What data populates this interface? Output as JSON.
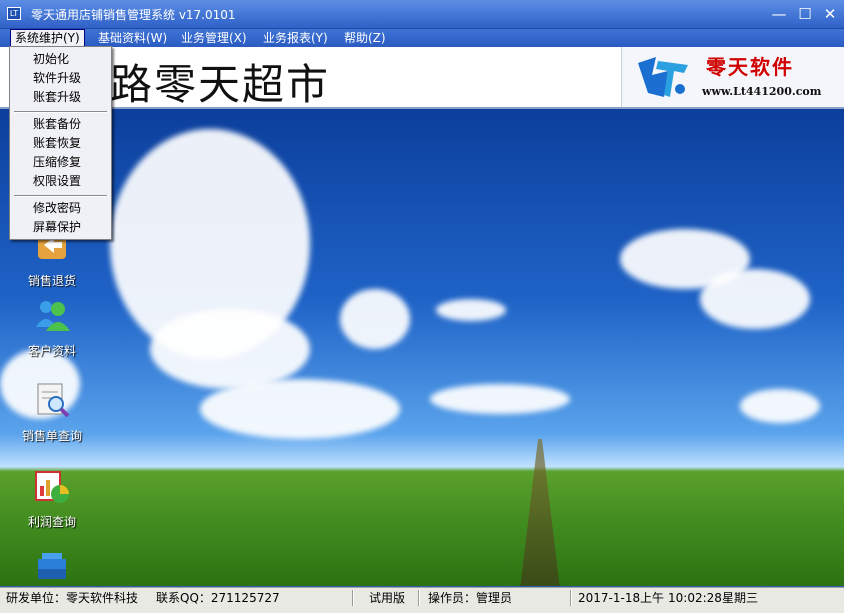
{
  "window": {
    "title": "零天通用店铺销售管理系统  v17.0101",
    "icon_text": "LT",
    "minimize_glyph": "—",
    "maximize_glyph": "☐",
    "close_glyph": "✕"
  },
  "menu": [
    {
      "label": "系统维护(Y)"
    },
    {
      "label": "基础资料(W)"
    },
    {
      "label": "业务管理(X)"
    },
    {
      "label": "业务报表(Y)"
    },
    {
      "label": "帮助(Z)"
    }
  ],
  "banner": {
    "title": "路零天超市",
    "logo_name": "零天软件",
    "logo_url": "www.Lt441200.com"
  },
  "dropdown": {
    "groups": [
      [
        "初始化",
        "软件升级",
        "账套升级"
      ],
      [
        "账套备份",
        "账套恢复",
        "压缩修复",
        "权限设置"
      ],
      [
        "修改密码",
        "屏幕保护"
      ]
    ]
  },
  "desktop_icons": [
    {
      "label": "销售退货",
      "icon": "return-icon"
    },
    {
      "label": "客户资料",
      "icon": "customers-icon"
    },
    {
      "label": "销售单查询",
      "icon": "order-search-icon"
    },
    {
      "label": "利润查询",
      "icon": "profit-chart-icon"
    },
    {
      "label": "",
      "icon": "books-icon"
    }
  ],
  "status": {
    "developer": "研发单位：零天软件科技",
    "contact": "联系QQ：271125727",
    "edition": "试用版",
    "operator": "操作员：管理员",
    "date": "2017-1-18",
    "ampm": "上午",
    "time": "10:02:28",
    "weekday": "星期三"
  },
  "colors": {
    "titlebar": "#2f61c8",
    "logo_red": "#d00000",
    "logo_blue": "#1a6fd0"
  }
}
